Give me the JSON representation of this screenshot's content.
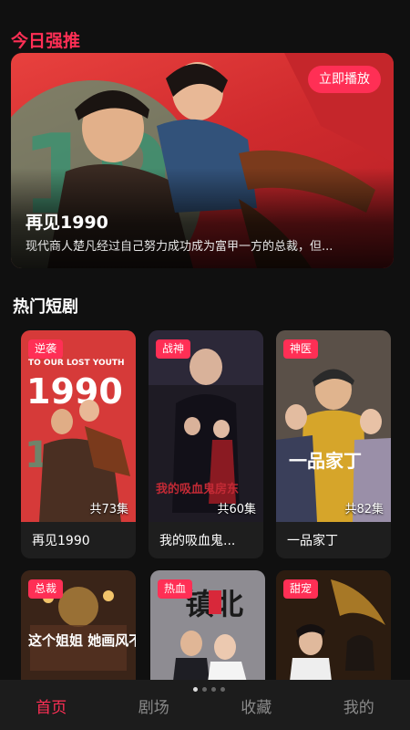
{
  "today": {
    "title": "今日强推",
    "hero": {
      "play_label": "立即播放",
      "name": "再见1990",
      "description": "现代商人楚凡经过自己努力成功成为富甲一方的总裁，但..."
    }
  },
  "hot": {
    "title": "热门短剧",
    "cards": [
      {
        "tag": "逆袭",
        "episodes": "共73集",
        "title": "再见1990",
        "poster_text": "TO OUR LOST YOUTH",
        "poster_big": "1990"
      },
      {
        "tag": "战神",
        "episodes": "共60集",
        "title": "我的吸血鬼...",
        "poster_text": "我的吸血鬼房东"
      },
      {
        "tag": "神医",
        "episodes": "共82集",
        "title": "一品家丁",
        "poster_text": "一品家丁"
      },
      {
        "tag": "总裁",
        "poster_text": "这个姐姐 她画风不对"
      },
      {
        "tag": "热血",
        "poster_text": "镇北"
      },
      {
        "tag": "甜宠"
      }
    ]
  },
  "tabs": [
    "首页",
    "剧场",
    "收藏",
    "我的"
  ],
  "colors": {
    "accent": "#ff2f55",
    "background": "#101010"
  }
}
